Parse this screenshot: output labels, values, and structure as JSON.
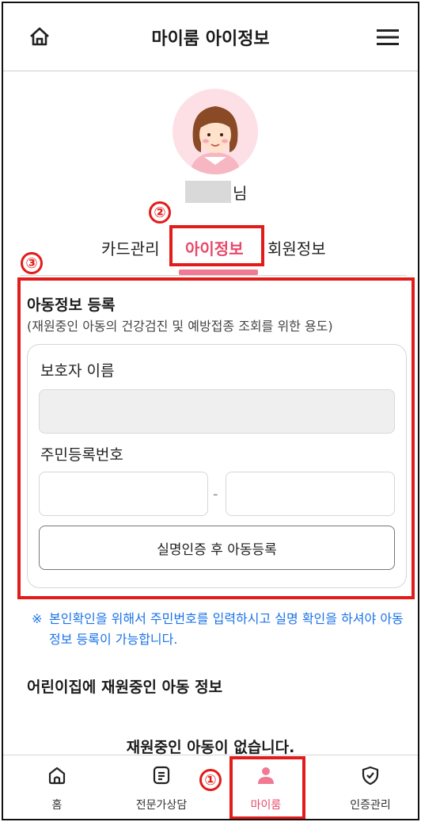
{
  "header": {
    "title": "마이룸 아이정보",
    "home_icon": "home-icon",
    "menu_icon": "hamburger-menu-icon"
  },
  "profile": {
    "avatar_icon": "girl-avatar",
    "name_suffix": "님"
  },
  "tabs": [
    {
      "label": "카드관리",
      "active": false
    },
    {
      "label": "아이정보",
      "active": true
    },
    {
      "label": "회원정보",
      "active": false
    }
  ],
  "markers": [
    "①",
    "②",
    "③"
  ],
  "registration": {
    "title": "아동정보 등록",
    "subtitle": "(재원중인 아동의 건강검진 및 예방접종 조회를 위한 용도)",
    "guardian_label": "보호자 이름",
    "guardian_value": "",
    "rrn_label": "주민등록번호",
    "rrn_front": "",
    "rrn_back": "",
    "rrn_separator": "-",
    "button_label": "실명인증 후 아동등록"
  },
  "notice": {
    "mark": "※",
    "text": "본인확인을 위해서 주민번호를 입력하시고 실명 확인을 하셔야 아동정보 등록이 가능합니다."
  },
  "enrolled": {
    "title": "어린이집에 재원중인 아동 정보",
    "empty_message": "재원중인 아동이 없습니다."
  },
  "bottom_nav": [
    {
      "label": "홈",
      "icon": "home-outline-icon",
      "active": false
    },
    {
      "label": "전문가상담",
      "icon": "document-icon",
      "active": false
    },
    {
      "label": "마이룸",
      "icon": "person-icon",
      "active": true
    },
    {
      "label": "인증관리",
      "icon": "shield-check-icon",
      "active": false
    }
  ],
  "colors": {
    "accent": "#e8496a",
    "annotation_red": "#e21b1b",
    "notice_blue": "#1a73e8"
  }
}
